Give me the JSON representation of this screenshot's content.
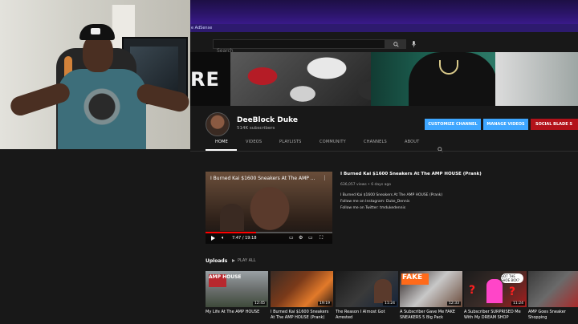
{
  "header": {
    "adsense_label": "e AdSense",
    "search_placeholder": "Search"
  },
  "banner": {
    "letters": "RE"
  },
  "channel": {
    "name": "DeeBlock Duke",
    "subscribers": "514K subscribers",
    "buttons": {
      "customize": "CUSTOMIZE CHANNEL",
      "manage": "MANAGE VIDEOS",
      "socialblade": "SOCIAL BLADE S"
    }
  },
  "tabs": [
    "HOME",
    "VIDEOS",
    "PLAYLISTS",
    "COMMUNITY",
    "CHANNELS",
    "ABOUT"
  ],
  "featured": {
    "player_title": "I Burned Kai $1600 Sneakers At The AMP ...",
    "time": "7:47 / 19:18",
    "progress": 0.4,
    "title": "I Burned Kai $1600 Sneakers At The AMP HOUSE (Prank)",
    "meta": "636,057 views • 6 days ago",
    "desc": [
      "I Burned Kai $1600 Sneakers At The AMP HOUSE (Prank)",
      "Follow me on Instagram: Duke_Dennis",
      "Follow me on Twitter: tmdukedennis"
    ]
  },
  "uploads": {
    "label": "Uploads",
    "play_all": "PLAY ALL",
    "videos": [
      {
        "title": "My Life At The AMP HOUSE",
        "duration": "12:45",
        "badge": "AMP HOUSE"
      },
      {
        "title": "I Burned Kai $1600 Sneakers At The AMP HOUSE (Prank)",
        "duration": "19:19"
      },
      {
        "title": "The Reason I Almost Got Arrested",
        "duration": "11:24"
      },
      {
        "title": "A Subscriber Gave Me FAKE SNEAKERS 5 Big Pack",
        "duration": "12:33",
        "badge": "FAKE"
      },
      {
        "title": "A Subscriber SURPRISED Me With My DREAM SHOP",
        "duration": "11:24",
        "bubble": "GOT THE SHOE BOX?"
      },
      {
        "title": "AMP Goes Sneaker Shopping"
      }
    ]
  },
  "colors": {
    "accent_blue": "#3ea6ff",
    "socialblade_red": "#b3121a",
    "background": "#181818",
    "progress_red": "#ff0000"
  }
}
